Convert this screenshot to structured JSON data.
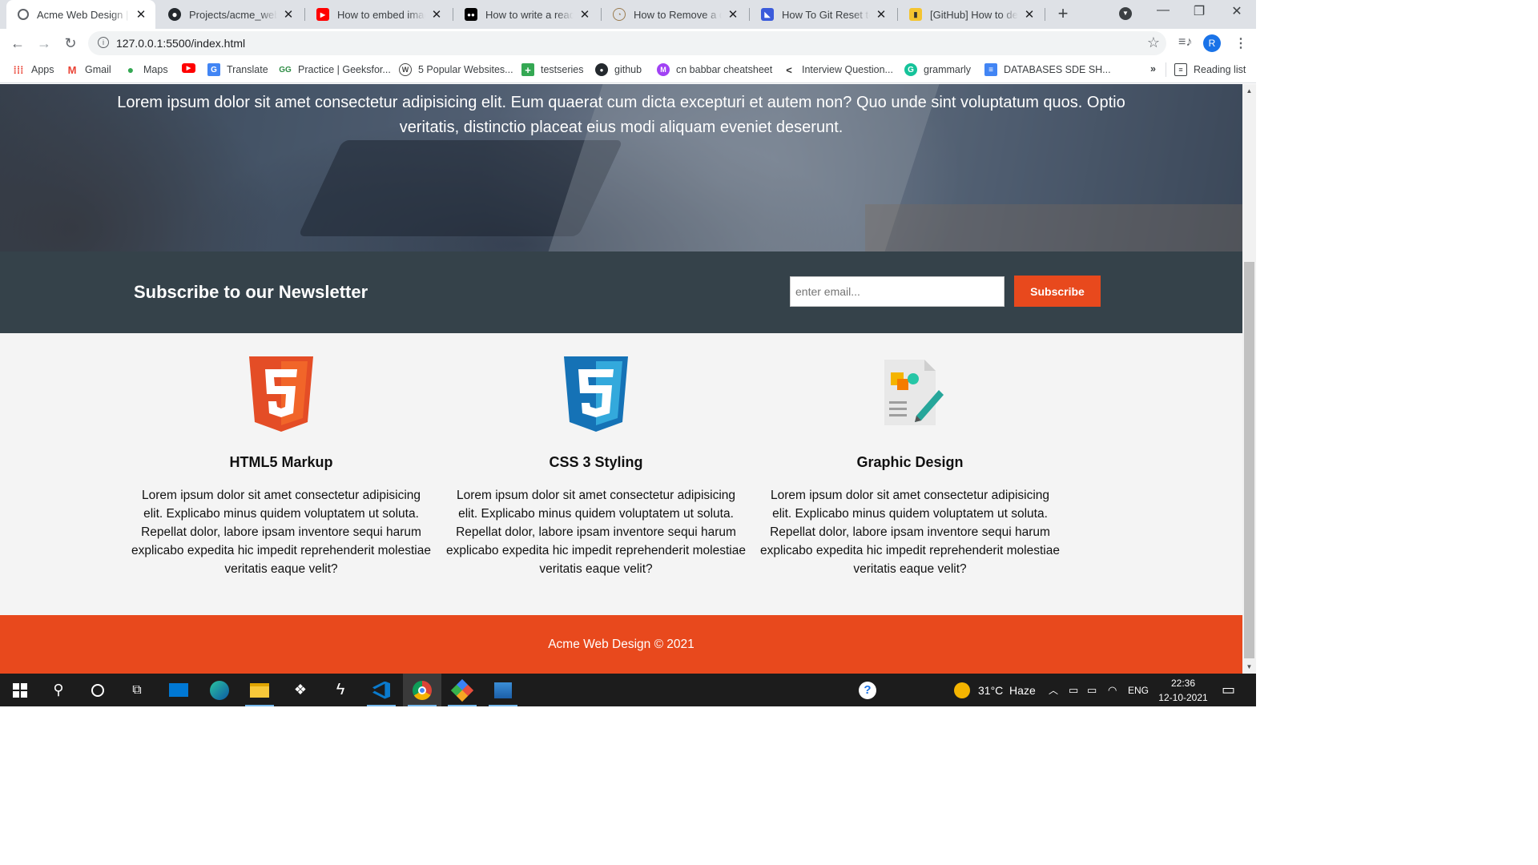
{
  "browser": {
    "tabs": [
      {
        "title": "Acme Web Design | welcome",
        "icon": "globe-icon",
        "active": true
      },
      {
        "title": "Projects/acme_web design",
        "icon": "github-icon"
      },
      {
        "title": "How to embed images in readme",
        "icon": "youtube-icon"
      },
      {
        "title": "How to write a readme",
        "icon": "medium-icon"
      },
      {
        "title": "How to Remove a directory",
        "icon": "stackoverflow-icon"
      },
      {
        "title": "How To Git Reset to HEAD",
        "icon": "freecodecamp-icon"
      },
      {
        "title": "[GitHub] How to delete",
        "icon": "bookmark-icon"
      }
    ],
    "url": "127.0.0.1:5500/index.html",
    "profile_initial": "R",
    "bookmarks": [
      {
        "label": "Apps",
        "icon": "apps-grid-icon"
      },
      {
        "label": "Gmail",
        "icon": "gmail-icon"
      },
      {
        "label": "Maps",
        "icon": "maps-pin-icon"
      },
      {
        "label": "",
        "icon": "youtube-icon"
      },
      {
        "label": "Translate",
        "icon": "translate-icon"
      },
      {
        "label": "Practice | Geeksfor...",
        "icon": "geeksforgeeks-icon"
      },
      {
        "label": "5 Popular Websites...",
        "icon": "wordpress-icon"
      },
      {
        "label": "testseries",
        "icon": "plus-square-icon"
      },
      {
        "label": "github",
        "icon": "github-icon"
      },
      {
        "label": "cn babbar cheatsheet",
        "icon": "m-circle-icon"
      },
      {
        "label": "Interview Question...",
        "icon": "bracket-icon"
      },
      {
        "label": "grammarly",
        "icon": "grammarly-icon"
      },
      {
        "label": "DATABASES SDE SH...",
        "icon": "docs-icon"
      }
    ],
    "bookmarks_overflow": "»",
    "reading_list": "Reading list"
  },
  "page": {
    "hero_text": "Lorem ipsum dolor sit amet consectetur adipisicing elit. Eum quaerat cum dicta excepturi et autem non? Quo unde sint voluptatum quos. Optio veritatis, distinctio placeat eius modi aliquam eveniet deserunt.",
    "newsletter": {
      "heading": "Subscribe to our Newsletter",
      "email_placeholder": "enter email...",
      "button_label": "Subscribe"
    },
    "boxes": [
      {
        "title": "HTML5 Markup",
        "icon": "html5-logo-icon",
        "text": "Lorem ipsum dolor sit amet consectetur adipisicing elit. Explicabo minus quidem voluptatem ut soluta. Repellat dolor, labore ipsam inventore sequi harum explicabo expedita hic impedit reprehenderit molestiae veritatis eaque velit?"
      },
      {
        "title": "CSS 3 Styling",
        "icon": "css3-logo-icon",
        "text": "Lorem ipsum dolor sit amet consectetur adipisicing elit. Explicabo minus quidem voluptatem ut soluta. Repellat dolor, labore ipsam inventore sequi harum explicabo expedita hic impedit reprehenderit molestiae veritatis eaque velit?"
      },
      {
        "title": "Graphic Design",
        "icon": "graphic-design-icon",
        "text": "Lorem ipsum dolor sit amet consectetur adipisicing elit. Explicabo minus quidem voluptatem ut soluta. Repellat dolor, labore ipsam inventore sequi harum explicabo expedita hic impedit reprehenderit molestiae veritatis eaque velit?"
      }
    ],
    "footer": "Acme Web Design © 2021",
    "colors": {
      "accent": "#e8491d",
      "dark": "#35424a",
      "background": "#f4f4f4"
    }
  },
  "taskbar": {
    "weather": "31°C  Haze",
    "language": "ENG",
    "time": "22:36",
    "date": "12-10-2021"
  }
}
